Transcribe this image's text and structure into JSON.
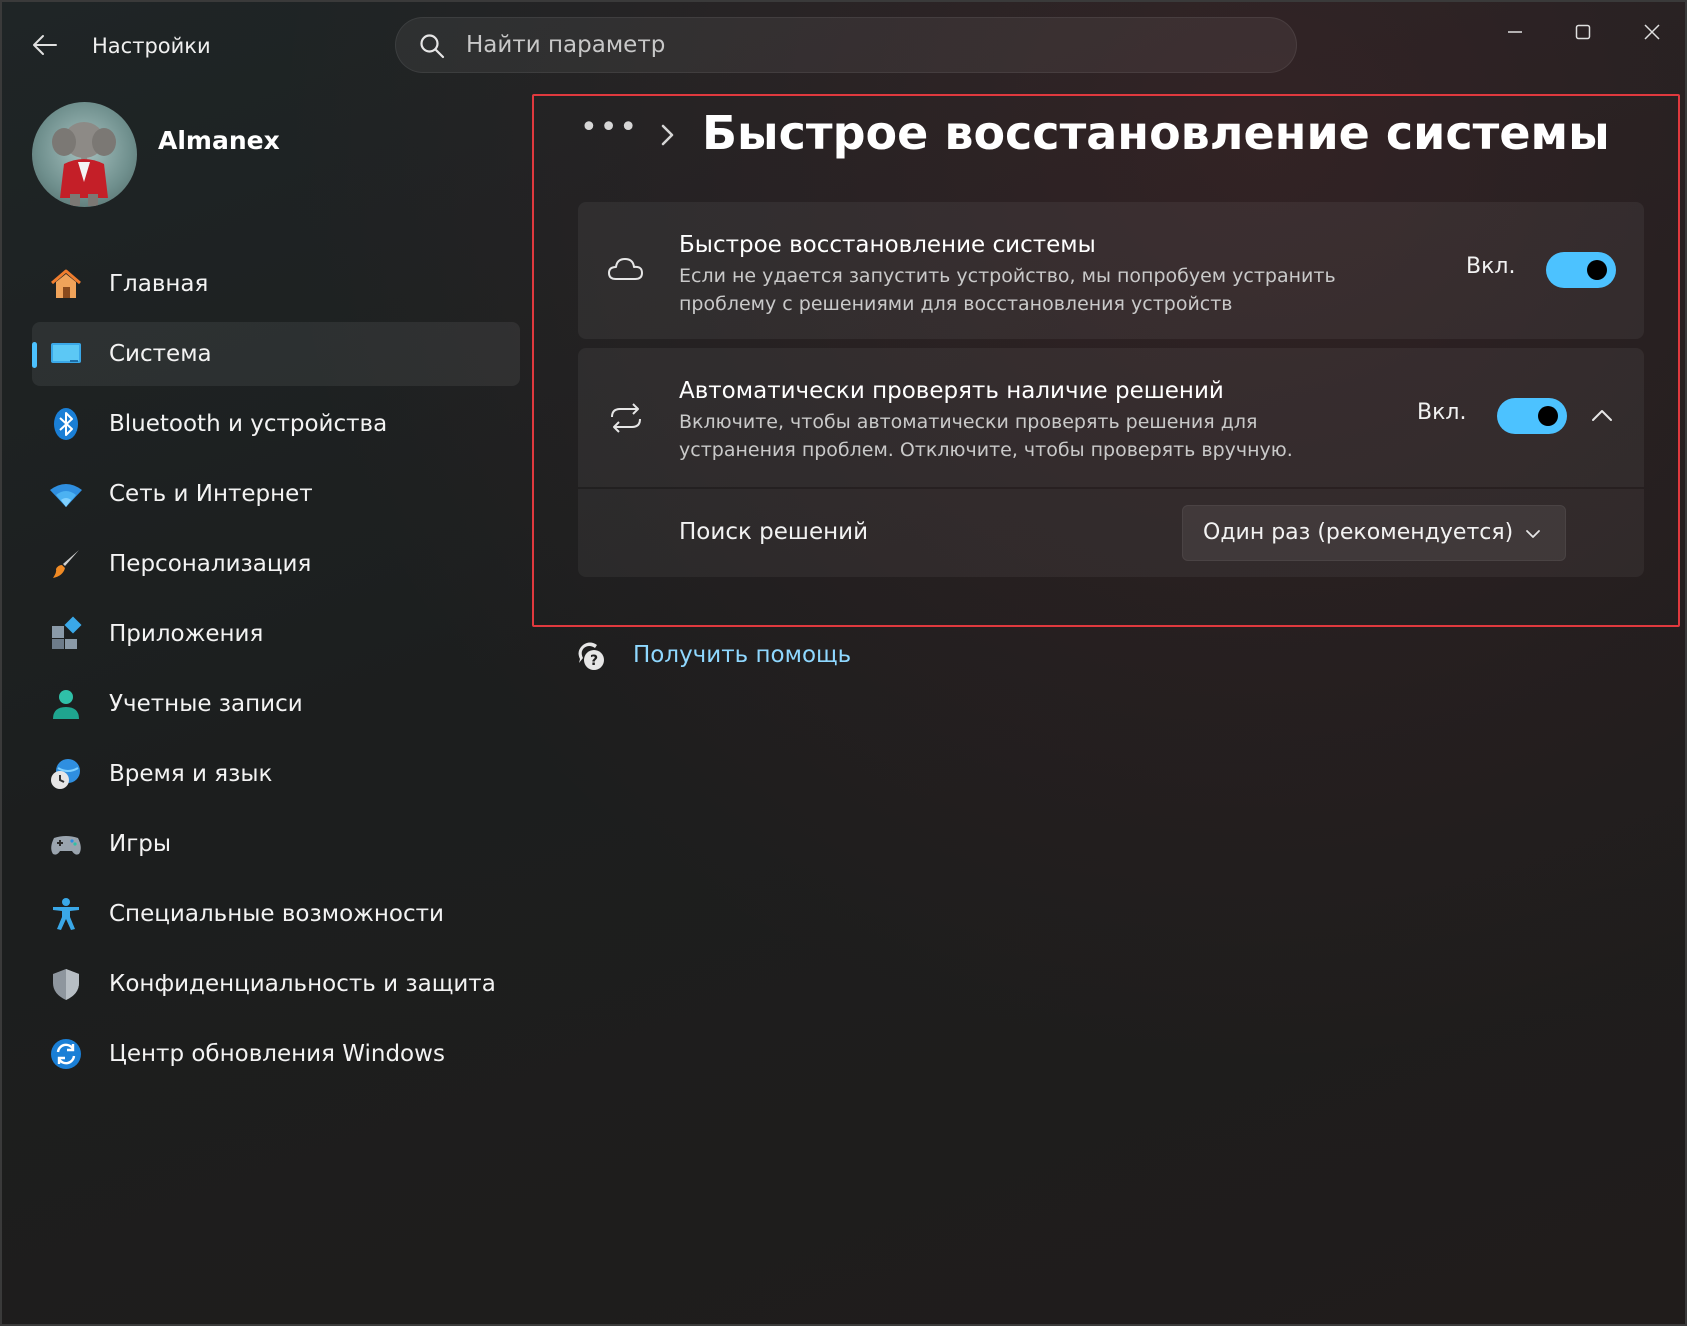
{
  "window": {
    "app_title": "Настройки",
    "search_placeholder": "Найти параметр"
  },
  "user": {
    "name": "Almanex"
  },
  "sidebar": {
    "active_index": 1,
    "accent_color": "#4cc2ff",
    "items": [
      {
        "label": "Главная",
        "icon": "home-icon"
      },
      {
        "label": "Система",
        "icon": "system-monitor-icon"
      },
      {
        "label": "Bluetooth и устройства",
        "icon": "bluetooth-icon"
      },
      {
        "label": "Сеть и Интернет",
        "icon": "wifi-icon"
      },
      {
        "label": "Персонализация",
        "icon": "paintbrush-icon"
      },
      {
        "label": "Приложения",
        "icon": "apps-icon"
      },
      {
        "label": "Учетные записи",
        "icon": "account-icon"
      },
      {
        "label": "Время и язык",
        "icon": "time-language-icon"
      },
      {
        "label": "Игры",
        "icon": "gamepad-icon"
      },
      {
        "label": "Специальные возможности",
        "icon": "accessibility-icon"
      },
      {
        "label": "Конфиденциальность и защита",
        "icon": "shield-icon"
      },
      {
        "label": "Центр обновления Windows",
        "icon": "windows-update-icon"
      }
    ]
  },
  "main": {
    "breadcrumb_more": "•••",
    "page_title": "Быстрое восстановление системы",
    "settings": [
      {
        "title": "Быстрое восстановление системы",
        "description": "Если не удается запустить устройство, мы попробуем устранить проблему с решениями для восстановления устройств",
        "state_label": "Вкл.",
        "on": true,
        "icon": "cloud-icon"
      },
      {
        "title": "Автоматически проверять наличие решений",
        "description": "Включите, чтобы автоматически проверять решения для устранения проблем. Отключите, чтобы проверять вручную.",
        "state_label": "Вкл.",
        "on": true,
        "icon": "sync-icon",
        "expanded": true
      }
    ],
    "sub_setting": {
      "label": "Поиск решений",
      "selected": "Один раз (рекомендуется)"
    },
    "help_link": "Получить помощь"
  }
}
